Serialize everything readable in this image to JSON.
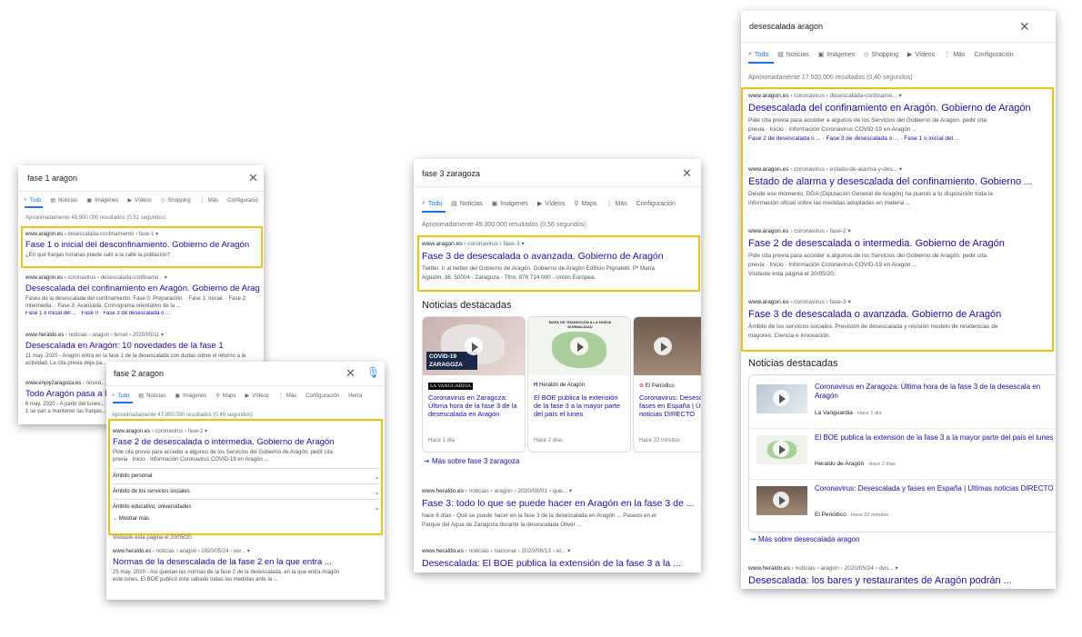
{
  "tabs": {
    "todo": "Todo",
    "noticias": "Noticias",
    "imagenes": "Imágenes",
    "videos": "Vídeos",
    "shopping": "Shopping",
    "maps": "Maps",
    "mas": "Más",
    "config_short": "Configuració",
    "config": "Configuración",
    "herra": "Herra"
  },
  "panel1": {
    "query": "fase 1 aragon",
    "stats": "Aproximadamente 48.900.000 resultados (0,51 segundos)",
    "results": [
      {
        "url": "www.aragon.es",
        "path": "› desescalada-confinamiento › fase-1",
        "title": "Fase 1 o inicial del desconfinamiento. Gobierno de Aragón",
        "snippet": "¿En qué franjas horarias puede salir a la calle la población?"
      },
      {
        "url": "www.aragon.es",
        "path": "› coronavirus › desescalada-confiname...",
        "title": "Desescalada del confinamiento en Aragón. Gobierno de Aragón",
        "snippet1": "Fases de la desescalada del confinamiento. Fase 0: Preparación. · Fase 1: Inicial. · Fase 2:",
        "snippet2": "Intermedia. · Fase 3: Avanzada. Cronograma orientativo de la ...",
        "links": "Fase 1 o inicial del ... · Fase 0 · Fase 3 de desescalada o ..."
      },
      {
        "url": "www.heraldo.es",
        "path": "› noticias › aragon › teruel › 2020/05/11",
        "title": "Desescalada en Aragón: 10 novedades de la fase 1",
        "snippet1": "11 may. 2020 - Aragón entra en la fase 1 de la desescalada con dudas sobre el retorno a la",
        "snippet2": "actividad. La cita previa deja pa..."
      },
      {
        "url": "www.enjoyzaragoza.es",
        "path": "› noved...",
        "title": "Todo Aragón pasa a la",
        "snippet1": "6 may. 2020 - A partir del lunes...",
        "snippet2": "1 se van a mantener las franjas..."
      }
    ]
  },
  "panel2": {
    "query": "fase 2 aragon",
    "stats": "Aproximadamente 47.800.000 resultados (0,49 segundos)",
    "result1": {
      "url": "www.aragon.es",
      "path": "› coronavirus › fase-2",
      "title": "Fase 2 de desescalada o intermedia. Gobierno de Aragón",
      "snippet1": "Pide cita previa para acceder a algunos de los Servicios del Gobierno de Aragón. pedir cita",
      "snippet2": "previa · Inicio · Información Coronavirus COVID-19 en Aragón ..."
    },
    "accordion": [
      "Ámbito personal",
      "Ámbito de los servicios sociales",
      "Ámbito educativo, universidades"
    ],
    "show_more": "Mostrar más",
    "visited": "Visitaste esta página el 20/05/20.",
    "result2": {
      "url": "www.heraldo.es",
      "path": "› noticias › aragon › 2020/05/24 › nor...",
      "title": "Normas de la desescalada de la fase 2 en la que entra ...",
      "snippet1": "25 may. 2020 - Así quedan las normas de la fase 2 de la desescalada, en la que entra Aragón",
      "snippet2": "este lunes. El BOE publicó este sábado todas las medidas ante la ..."
    }
  },
  "panel3": {
    "query": "fase 3 zaragoza",
    "stats": "Aproximadamente 49.300.000 resultados (0,56 segundos)",
    "result1": {
      "url": "www.aragon.es",
      "path": "› coronavirus › fase-3",
      "title": "Fase 3 de desescalada o avanzada. Gobierno de Aragón",
      "snippet1": "Twitter. Ir al twitter del Gobierno de Aragón. Gobierno de Aragón Edificio Pignatelli. Pº María",
      "snippet2": "Agustín, 36. 50004 - Zaragoza - Tfno. 976 714 000 - Unión Europea."
    },
    "news_heading": "Noticias destacadas",
    "cards": [
      {
        "badge": "COVID-19 ZARAGOZA",
        "source": "LA VANGUARDIA",
        "title": "Coronavirus en Zaragoza: Última hora de la fase 3 de la desescalada en Aragón",
        "time": "Hace 1 día"
      },
      {
        "badge": "MAPA DE TRANSICIÓN A LA NUEVA NORMALIDAD",
        "source": "Heraldo de Aragón",
        "title": "El BOE publica la extensión de la fase 3 a la mayor parte del país el lunes",
        "time": "Hace 2 días"
      },
      {
        "source": "El Periódico",
        "title": "Coronavirus: Desescalada y fases en España | Últimas noticias DIRECTO",
        "time": "Hace 22 minutos"
      }
    ],
    "more_news": "Más sobre fase 3 zaragoza",
    "result2": {
      "url": "www.heraldo.es",
      "path": "› noticias › aragon › 2020/06/01 › que... ▾",
      "title": "Fase 3: todo lo que se puede hacer en Aragón en la fase 3 de ...",
      "snippet1": "hace 6 días - Qué se puede hacer en la fase 3 de la desescalada en Aragón ... Paseos en el",
      "snippet2": "Parque del Agua de Zaragoza durante la desescalada Oliver ..."
    },
    "result3": {
      "url": "www.heraldo.es",
      "path": "› noticias › nacional › 2020/06/13 › el... ▾",
      "title": "Desescalada: El BOE publica la extensión de la fase 3 a la ..."
    }
  },
  "panel4": {
    "query": "desescalada aragon",
    "stats": "Aproximadamente 17.500.000 resultados (0,40 segundos)",
    "results": [
      {
        "url": "www.aragon.es",
        "path": "› coronavirus › desescalada-confiname...",
        "title": "Desescalada del confinamiento en Aragón. Gobierno de Aragón",
        "snippet1": "Pide cita previa para acceder a algunos de los Servicios del Gobierno de Aragón. pedir cita",
        "snippet2": "previa · Inicio · Información Coronavirus COVID-19 en Aragón ...",
        "links": "Fase 2 de desescalada o ... · Fase 3 de desescalada o ... · Fase 1 o inicial del ..."
      },
      {
        "url": "www.aragon.es",
        "path": "› coronavirus › estado-de-alarma-y-des...",
        "title": "Estado de alarma y desescalada del confinamiento. Gobierno ...",
        "snippet1": "Desde ese momento, DGA (Diputación General de Aragón) ha puesto a tu disposición toda la",
        "snippet2": "información oficial sobre las medidas adoptadas en materia ..."
      },
      {
        "url": "www.aragon.es",
        "path": "› coronavirus › fase-2",
        "title": "Fase 2 de desescalada o intermedia. Gobierno de Aragón",
        "snippet1": "Pide cita previa para acceder a algunos de los Servicios del Gobierno de Aragón. pedir cita",
        "snippet2": "previa · Inicio · Información Coronavirus COVID-19 en Aragón ...",
        "snippet3": "Visitaste esta página el 20/05/20."
      },
      {
        "url": "www.aragon.es",
        "path": "› coronavirus › fase-3",
        "title": "Fase 3 de desescalada o avanzada. Gobierno de Aragón",
        "snippet1": "Ámbito de los servicios sociales. Previsión de desescalada y revisión modelo de residencias de",
        "snippet2": "mayores. Ciencia e innovación."
      }
    ],
    "news_heading": "Noticias destacadas",
    "news": [
      {
        "title": "Coronavirus en Zaragoza: Última hora de la fase 3 de la desescala en Aragón",
        "source": "La Vanguardia",
        "time": "· Hace 1 día"
      },
      {
        "title": "El BOE publica la extensión de la fase 3 a la mayor parte del país el lunes",
        "source": "Heraldo de Aragón",
        "time": "· Hace 2 días"
      },
      {
        "title": "Coronavirus: Desescalada y fases en España | Últimas noticias DIRECTO",
        "source": "El Periódico",
        "time": "· Hace 23 minutos"
      }
    ],
    "more_news": "Más sobre desescalada aragon",
    "result5": {
      "url": "www.heraldo.es",
      "path": "› noticias › aragon › 2020/05/24 › des... ▾",
      "title": "Desescalada: los bares y restaurantes de Aragón podrán ..."
    }
  },
  "colors": {
    "highlight": "#f4c20d",
    "link": "#1a0dab",
    "accent": "#1a73e8"
  }
}
